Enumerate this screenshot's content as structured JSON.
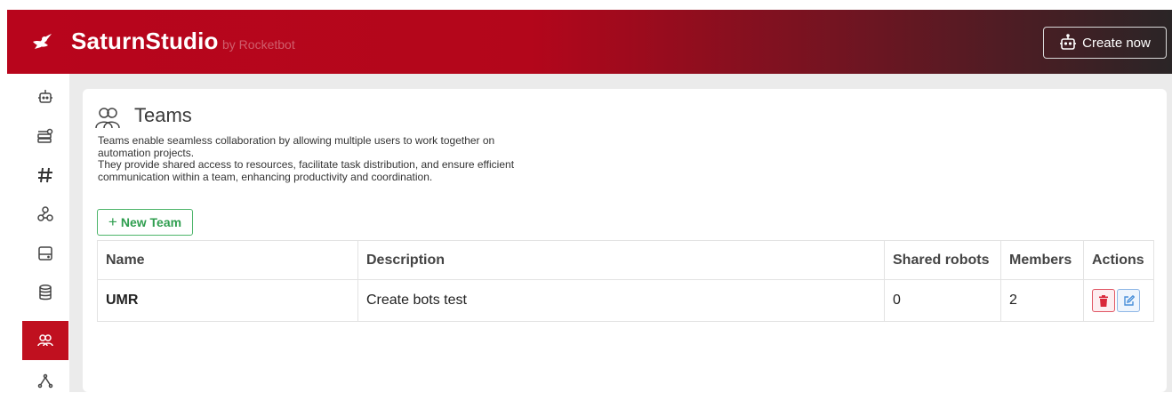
{
  "header": {
    "brand": "SaturnStudio",
    "brand_by": "by Rocketbot",
    "create_label": "Create now"
  },
  "sidebar": {
    "items": [
      {
        "icon": "robot-icon"
      },
      {
        "icon": "server-icon"
      },
      {
        "icon": "hashtag-icon"
      },
      {
        "icon": "webhook-icon"
      },
      {
        "icon": "drive-icon"
      },
      {
        "icon": "database-icon"
      },
      {
        "icon": "teams-icon",
        "active": true
      },
      {
        "icon": "network-icon"
      }
    ]
  },
  "page": {
    "title": "Teams",
    "description": [
      "Teams enable seamless collaboration by allowing multiple users to work together on",
      "automation projects.",
      "They provide shared access to resources, facilitate task distribution, and ensure efficient",
      "communication within a team, enhancing productivity and coordination."
    ],
    "new_team_label": "New Team"
  },
  "table": {
    "columns": [
      "Name",
      "Description",
      "Shared robots",
      "Members",
      "Actions"
    ],
    "rows": [
      {
        "name": "UMR",
        "description": "Create bots test",
        "shared_robots": "0",
        "members": "2"
      }
    ]
  },
  "colors": {
    "brand_red": "#b8051c",
    "active_red": "#c0101f",
    "success_green": "#2f9e4f",
    "danger": "#e05664",
    "info": "#4a90d9"
  }
}
